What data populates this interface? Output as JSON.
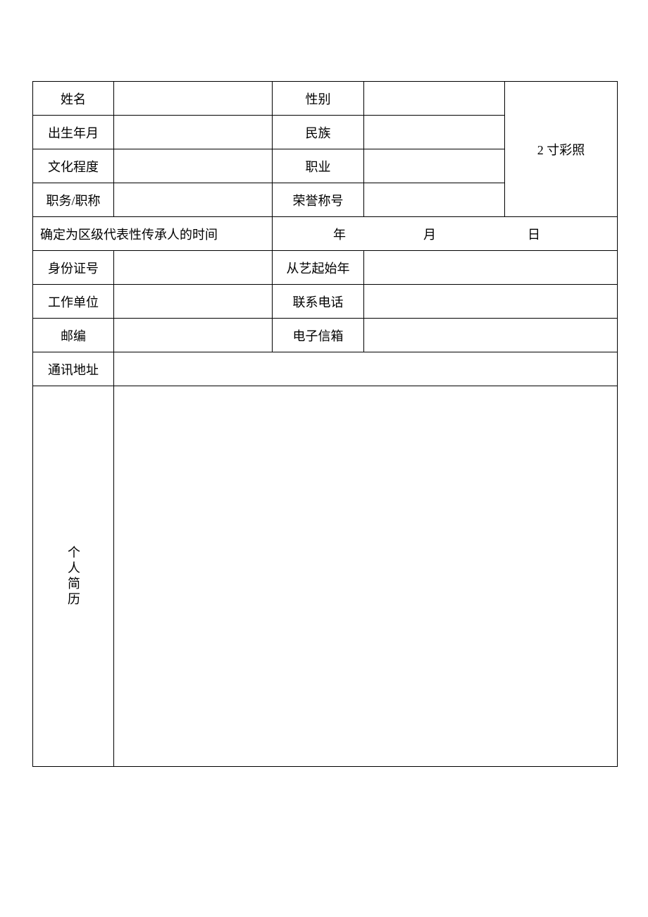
{
  "labels": {
    "name": "姓名",
    "gender": "性别",
    "birth": "出生年月",
    "ethnicity": "民族",
    "education": "文化程度",
    "occupation": "职业",
    "position": "职务/职称",
    "honor": "荣誉称号",
    "photo": "2 寸彩照",
    "district_time": "确定为区级代表性传承人的时间",
    "year": "年",
    "month": "月",
    "day": "日",
    "id_number": "身份证号",
    "art_start": "从艺起始年",
    "work_unit": "工作单位",
    "phone": "联系电话",
    "postcode": "邮编",
    "email": "电子信箱",
    "address": "通讯地址",
    "resume": "个人简历"
  },
  "values": {
    "name": "",
    "gender": "",
    "birth": "",
    "ethnicity": "",
    "education": "",
    "occupation": "",
    "position": "",
    "honor": "",
    "district_year": "",
    "district_month": "",
    "district_day": "",
    "id_number": "",
    "art_start": "",
    "work_unit": "",
    "phone": "",
    "postcode": "",
    "email": "",
    "address": "",
    "resume": ""
  }
}
